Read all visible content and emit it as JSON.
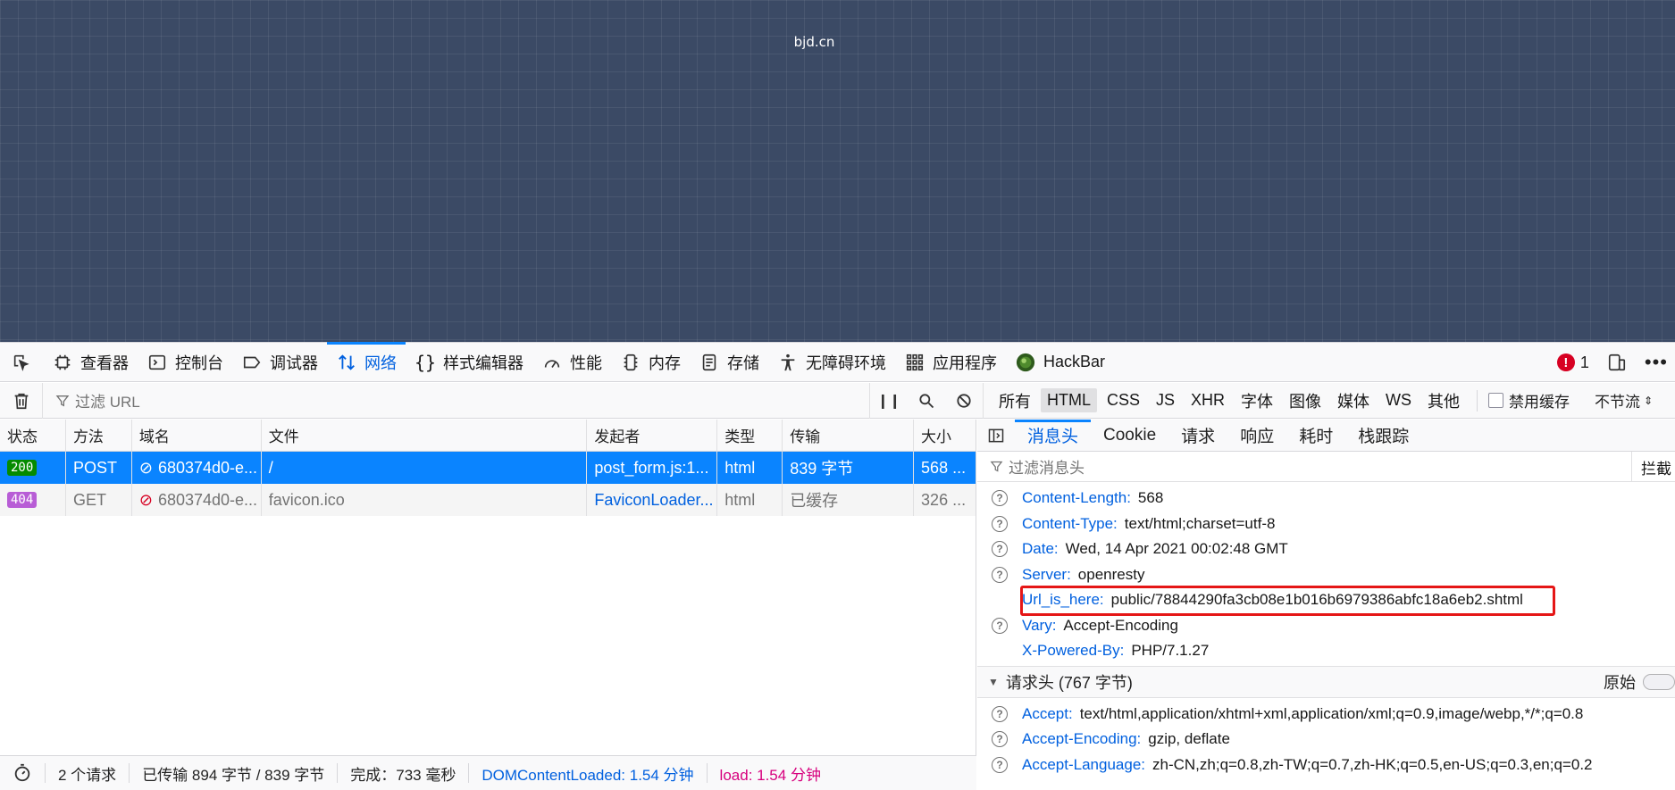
{
  "viewport": {
    "site_title": "bjd.cn"
  },
  "devtools_tabs": [
    {
      "label": "查看器",
      "icon": "inspector-icon"
    },
    {
      "label": "控制台",
      "icon": "console-icon"
    },
    {
      "label": "调试器",
      "icon": "debugger-icon"
    },
    {
      "label": "网络",
      "icon": "network-icon",
      "active": true
    },
    {
      "label": "样式编辑器",
      "icon": "style-editor-icon"
    },
    {
      "label": "性能",
      "icon": "performance-icon"
    },
    {
      "label": "内存",
      "icon": "memory-icon"
    },
    {
      "label": "存储",
      "icon": "storage-icon"
    },
    {
      "label": "无障碍环境",
      "icon": "accessibility-icon"
    },
    {
      "label": "应用程序",
      "icon": "application-icon"
    },
    {
      "label": "HackBar",
      "icon": "hackbar-icon"
    }
  ],
  "error_count": "1",
  "net_toolbar": {
    "filter_placeholder": "过滤 URL",
    "type_filters": [
      "所有",
      "HTML",
      "CSS",
      "JS",
      "XHR",
      "字体",
      "图像",
      "媒体",
      "WS",
      "其他"
    ],
    "selected_filter": "HTML",
    "disable_cache": "禁用缓存",
    "throttle": "不节流"
  },
  "columns": [
    "状态",
    "方法",
    "域名",
    "文件",
    "发起者",
    "类型",
    "传输",
    "大小"
  ],
  "requests": [
    {
      "status": "200",
      "method": "POST",
      "domain": "680374d0-e...",
      "file": "/",
      "initiator": "post_form.js:1...",
      "type": "html",
      "transfer": "839 字节",
      "size": "568 ..."
    },
    {
      "status": "404",
      "method": "GET",
      "domain": "680374d0-e...",
      "file": "favicon.ico",
      "initiator": "FaviconLoader...",
      "type": "html",
      "transfer": "已缓存",
      "size": "326 ..."
    }
  ],
  "statusbar": {
    "requests": "2 个请求",
    "transferred": "已传输 894 字节 / 839 字节",
    "finish": "完成：733 毫秒",
    "dcl": "DOMContentLoaded: 1.54 分钟",
    "load": "load: 1.54 分钟"
  },
  "detail_tabs": [
    "消息头",
    "Cookie",
    "请求",
    "响应",
    "耗时",
    "栈跟踪"
  ],
  "header_filter": {
    "placeholder": "过滤消息头",
    "block_label": "拦截"
  },
  "response_headers": [
    {
      "name": "Content-Length:",
      "value": "568"
    },
    {
      "name": "Content-Type:",
      "value": "text/html;charset=utf-8"
    },
    {
      "name": "Date:",
      "value": "Wed, 14 Apr 2021 00:02:48 GMT"
    },
    {
      "name": "Server:",
      "value": "openresty"
    },
    {
      "name": "Url_is_here:",
      "value": "public/78844290fa3cb08e1b016b6979386abfc18a6eb2.shtml"
    },
    {
      "name": "Vary:",
      "value": "Accept-Encoding"
    },
    {
      "name": "X-Powered-By:",
      "value": "PHP/7.1.27"
    }
  ],
  "request_section": {
    "title": "请求头 (767 字节)",
    "raw_label": "原始"
  },
  "request_headers": [
    {
      "name": "Accept:",
      "value": "text/html,application/xhtml+xml,application/xml;q=0.9,image/webp,*/*;q=0.8"
    },
    {
      "name": "Accept-Encoding:",
      "value": "gzip, deflate"
    },
    {
      "name": "Accept-Language:",
      "value": "zh-CN,zh;q=0.8,zh-TW;q=0.7,zh-HK;q=0.5,en-US;q=0.3,en;q=0.2"
    }
  ]
}
